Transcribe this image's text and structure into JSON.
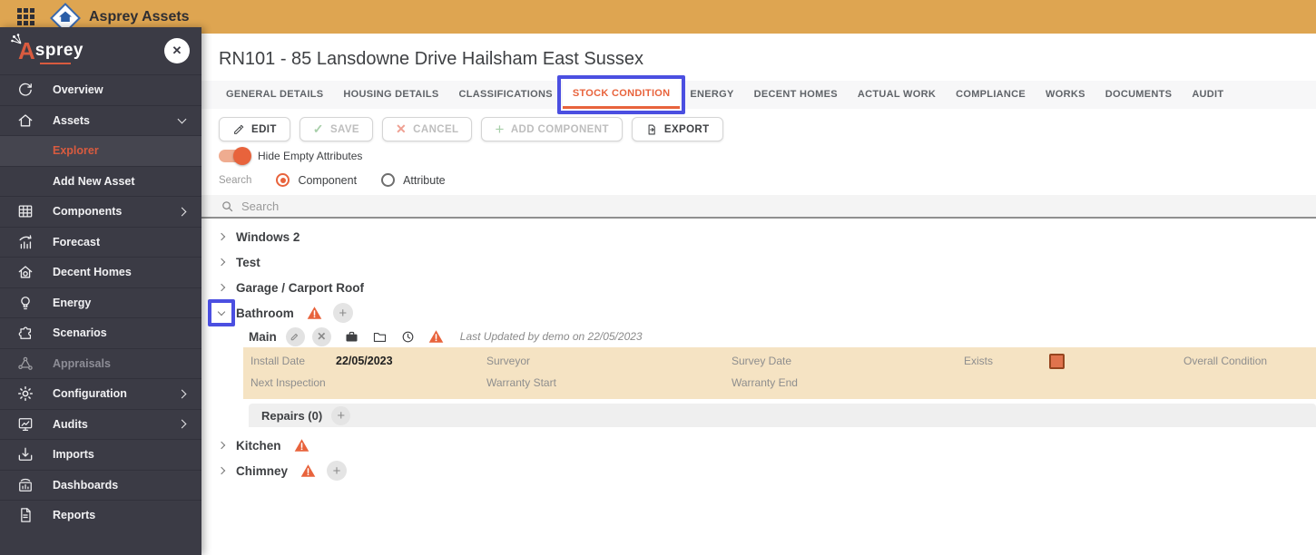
{
  "colors": {
    "topbar_bg": "#DEA551",
    "sidebar_bg": "#3B3B45",
    "accent_orange": "#E8633C",
    "annotation_blue": "#4B4FE1",
    "panel_beige": "#F5E3C3",
    "checkbox_fill": "#E0734D"
  },
  "topbar": {
    "app_title": "Asprey Assets"
  },
  "sidebar": {
    "brand": {
      "initial": "A",
      "rest": "sprey"
    },
    "close_glyph": "✕",
    "items": [
      {
        "label": "Overview",
        "icon": "overview-icon"
      },
      {
        "label": "Assets",
        "icon": "home-icon",
        "chevron": "down"
      },
      {
        "label": "Explorer",
        "child": true,
        "active": true
      },
      {
        "label": "Add New Asset",
        "child": true
      },
      {
        "label": "Components",
        "icon": "grid-icon",
        "chevron": "right"
      },
      {
        "label": "Forecast",
        "icon": "forecast-icon"
      },
      {
        "label": "Decent Homes",
        "icon": "decent-homes-icon"
      },
      {
        "label": "Energy",
        "icon": "bulb-icon"
      },
      {
        "label": "Scenarios",
        "icon": "puzzle-icon"
      },
      {
        "label": "Appraisals",
        "icon": "network-icon",
        "disabled": true
      },
      {
        "label": "Configuration",
        "icon": "gear-icon",
        "chevron": "right"
      },
      {
        "label": "Audits",
        "icon": "audit-chart-icon",
        "chevron": "right"
      },
      {
        "label": "Imports",
        "icon": "import-icon"
      },
      {
        "label": "Dashboards",
        "icon": "dashboard-icon"
      },
      {
        "label": "Reports",
        "icon": "report-icon"
      }
    ]
  },
  "main": {
    "title": "RN101 - 85 Lansdowne Drive Hailsham East Sussex",
    "tabs": [
      "GENERAL DETAILS",
      "HOUSING DETAILS",
      "CLASSIFICATIONS",
      "STOCK CONDITION",
      "ENERGY",
      "DECENT HOMES",
      "ACTUAL WORK",
      "COMPLIANCE",
      "WORKS",
      "DOCUMENTS",
      "AUDIT"
    ],
    "active_tab": "STOCK CONDITION",
    "toolbar": {
      "edit": "EDIT",
      "save": "SAVE",
      "cancel": "CANCEL",
      "add_component": "ADD COMPONENT",
      "export": "EXPORT"
    },
    "toggle_label": "Hide Empty Attributes",
    "search": {
      "label": "Search",
      "option_component": "Component",
      "option_attribute": "Attribute",
      "placeholder": "Search"
    },
    "tree": [
      {
        "label": "Windows 2"
      },
      {
        "label": "Test"
      },
      {
        "label": "Garage / Carport Roof"
      },
      {
        "label": "Bathroom",
        "expanded": true,
        "warning": true,
        "can_add": true
      },
      {
        "label": "Kitchen",
        "warning": true
      },
      {
        "label": "Chimney",
        "warning": true,
        "can_add": true
      }
    ],
    "detail": {
      "name": "Main",
      "last_updated": "Last Updated by demo on 22/05/2023",
      "fields_row1": [
        {
          "label": "Install Date",
          "value": "22/05/2023"
        },
        {
          "label": "Surveyor",
          "value": ""
        },
        {
          "label": "Survey Date",
          "value": ""
        },
        {
          "label": "Exists",
          "value": "checked"
        },
        {
          "label": "Overall Condition",
          "value": ""
        }
      ],
      "fields_row2": [
        {
          "label": "Next Inspection",
          "value": ""
        },
        {
          "label": "Warranty Start",
          "value": ""
        },
        {
          "label": "Warranty End",
          "value": ""
        }
      ],
      "repairs_label": "Repairs (0)"
    }
  }
}
